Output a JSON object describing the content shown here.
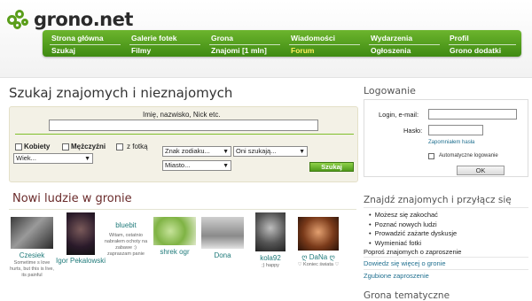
{
  "brand": {
    "logo_text": "grono.net",
    "accent": "#4f9a1a",
    "highlight": "#ffef5a"
  },
  "nav": {
    "row1": [
      "Strona główna",
      "Galerie fotek",
      "Grona",
      "Wiadomości",
      "Wydarzenia",
      "Profil"
    ],
    "row2": [
      "Szukaj",
      "Filmy",
      "Znajomi [1 mln]",
      "Forum",
      "Ogłoszenia",
      "Grono dodatki"
    ]
  },
  "search": {
    "title": "Szukaj znajomych i nieznajomych",
    "name_label": "Imię, nazwisko, Nick etc.",
    "name_value": "",
    "women_label": "Kobiety",
    "men_label": "Mężczyźni",
    "photo_label": "z fotką",
    "age_select": "Wiek...",
    "zodiac_select": "Znak zodiaku...",
    "looking_select": "Oni szukają...",
    "city_select": "Miasto...",
    "submit_label": "Szukaj"
  },
  "new_people": {
    "title": "Nowi ludzie w gronie",
    "people": [
      {
        "name": "Czesiek",
        "desc": "Sometime s love hurts, but this is live, its painful"
      },
      {
        "name": "Igor Pekalowski",
        "desc": ""
      },
      {
        "name": "bluebit",
        "desc": "Witam, ostatnio nabrałem ochoty na zabawe :) zapraszam panie"
      },
      {
        "name": "shrek ogr",
        "desc": ""
      },
      {
        "name": "Dona",
        "desc": ""
      },
      {
        "name": "kola92",
        "desc": ";) happy"
      },
      {
        "name": "ღ DaNa ღ",
        "desc": "♡ Koniec świata ♡"
      }
    ]
  },
  "login": {
    "title": "Logowanie",
    "email_label": "Login, e-mail:",
    "password_label": "Hasło:",
    "email_value": "",
    "password_value": "",
    "forgot_label": "Zapomniałem hasła",
    "auto_login_label": "Automatyczne logowanie",
    "ok_label": "OK"
  },
  "find": {
    "title": "Znajdź znajomych i przyłącz się",
    "bullets": [
      "Możesz się zakochać",
      "Poznać nowych ludzi",
      "Prowadzić zażarte dyskusje",
      "Wymieniać fotki"
    ],
    "invite_text": "Poproś znajomych o zaproszenie",
    "more_link": "Dowiedz się więcej o gronie",
    "report_link": "Zgubione zaproszenie"
  },
  "groups": {
    "title": "Grona tematyczne"
  }
}
